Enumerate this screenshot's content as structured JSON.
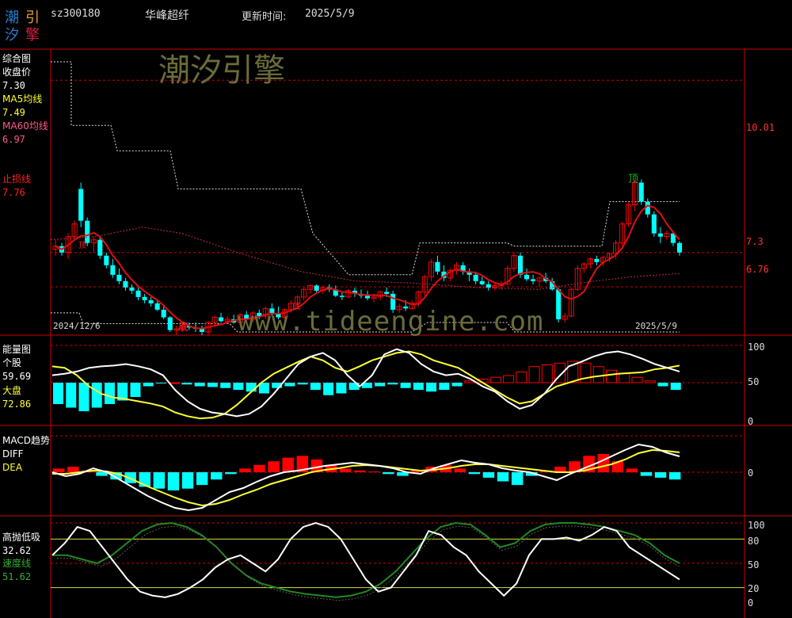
{
  "header": {
    "logo": "潮汐引擎",
    "code": "sz300180",
    "name": "华峰超纤",
    "update_label": "更新时间:",
    "update_date": "2025/5/9"
  },
  "watermark": {
    "brand": "潮汐引擎",
    "url": "www.tideengine.com"
  },
  "colors": {
    "up": "#ff0000",
    "down": "#00ffff",
    "white": "#ffffff",
    "yellow": "#ffff33",
    "red_line": "#e01010",
    "pink": "#ff5a8a",
    "green": "#208a20",
    "grid": "#cc0000",
    "watermark": "#6b6b3a"
  },
  "panels": {
    "main": {
      "title": "综合图",
      "close_label": "收盘价",
      "close_value": "7.30",
      "ma5_label": "MA5均线",
      "ma5_value": "7.49",
      "ma60_label": "MA60均线",
      "ma60_value": "6.97",
      "stop_label": "止损线",
      "stop_value": "7.76",
      "axis_labels": [
        "10.01",
        "7.3",
        "6.76"
      ],
      "date_start": "2024/12/6",
      "date_end": "2025/5/9",
      "marker_top": "顶",
      "marker_bottom": "底",
      "small_marks": [
        "顶",
        "底"
      ]
    },
    "energy": {
      "title": "能量图",
      "stock_label": "个股",
      "stock_value": "59.69",
      "market_label": "大盘",
      "market_value": "72.86",
      "axis_labels": [
        "100",
        "50",
        "0"
      ]
    },
    "macd": {
      "title": "MACD趋势",
      "diff_label": "DIFF",
      "dea_label": "DEA",
      "axis_labels": [
        "0"
      ]
    },
    "timing": {
      "title": "高抛低吸",
      "value": "32.62",
      "speed_label": "速度线",
      "speed_value": "51.62",
      "axis_labels": [
        "100",
        "80",
        "50",
        "20",
        "0"
      ]
    }
  },
  "chart_data": {
    "type": "candlestick",
    "x_range": [
      "2024/12/6",
      "2025/5/9"
    ],
    "price_axis": [
      6.76,
      7.3,
      10.01
    ],
    "candles_ohlc": [
      [
        7.35,
        7.5,
        7.25,
        7.4
      ],
      [
        7.4,
        7.45,
        7.25,
        7.3
      ],
      [
        7.3,
        7.6,
        7.2,
        7.55
      ],
      [
        7.55,
        7.8,
        7.5,
        7.75
      ],
      [
        8.3,
        8.4,
        7.7,
        7.8
      ],
      [
        7.8,
        7.85,
        7.4,
        7.45
      ],
      [
        7.45,
        7.55,
        7.3,
        7.5
      ],
      [
        7.5,
        7.55,
        7.2,
        7.25
      ],
      [
        7.25,
        7.3,
        7.05,
        7.1
      ],
      [
        7.1,
        7.2,
        6.9,
        6.95
      ],
      [
        6.95,
        7.05,
        6.8,
        6.85
      ],
      [
        6.85,
        6.9,
        6.7,
        6.75
      ],
      [
        6.75,
        6.8,
        6.65,
        6.7
      ],
      [
        6.7,
        6.75,
        6.55,
        6.6
      ],
      [
        6.6,
        6.65,
        6.5,
        6.55
      ],
      [
        6.55,
        6.6,
        6.45,
        6.5
      ],
      [
        6.5,
        6.55,
        6.38,
        6.4
      ],
      [
        6.4,
        6.45,
        6.25,
        6.28
      ],
      [
        6.28,
        6.3,
        6.05,
        6.08
      ],
      [
        6.08,
        6.15,
        6.0,
        6.1
      ],
      [
        6.1,
        6.18,
        6.05,
        6.15
      ],
      [
        6.15,
        6.2,
        6.08,
        6.12
      ],
      [
        6.12,
        6.2,
        6.05,
        6.1
      ],
      [
        6.1,
        6.15,
        6.0,
        6.05
      ],
      [
        6.05,
        6.22,
        6.0,
        6.2
      ],
      [
        6.2,
        6.3,
        6.12,
        6.28
      ],
      [
        6.28,
        6.35,
        6.2,
        6.22
      ],
      [
        6.22,
        6.3,
        6.18,
        6.25
      ],
      [
        6.25,
        6.32,
        6.18,
        6.2
      ],
      [
        6.2,
        6.35,
        6.15,
        6.32
      ],
      [
        6.32,
        6.38,
        6.22,
        6.25
      ],
      [
        6.25,
        6.38,
        6.2,
        6.35
      ],
      [
        6.35,
        6.4,
        6.25,
        6.3
      ],
      [
        6.3,
        6.45,
        6.25,
        6.42
      ],
      [
        6.42,
        6.5,
        6.3,
        6.35
      ],
      [
        6.35,
        6.45,
        6.25,
        6.28
      ],
      [
        6.28,
        6.42,
        6.25,
        6.4
      ],
      [
        6.4,
        6.55,
        6.35,
        6.5
      ],
      [
        6.5,
        6.62,
        6.45,
        6.6
      ],
      [
        6.6,
        6.75,
        6.55,
        6.72
      ],
      [
        6.72,
        6.8,
        6.65,
        6.78
      ],
      [
        6.78,
        6.8,
        6.65,
        6.7
      ],
      [
        6.7,
        6.78,
        6.65,
        6.75
      ],
      [
        6.75,
        6.8,
        6.68,
        6.72
      ],
      [
        6.72,
        6.78,
        6.6,
        6.62
      ],
      [
        6.62,
        6.68,
        6.55,
        6.6
      ],
      [
        6.6,
        6.72,
        6.58,
        6.7
      ],
      [
        6.7,
        6.75,
        6.6,
        6.65
      ],
      [
        6.65,
        6.72,
        6.58,
        6.62
      ],
      [
        6.62,
        6.7,
        6.55,
        6.58
      ],
      [
        6.58,
        6.65,
        6.52,
        6.6
      ],
      [
        6.6,
        6.7,
        6.55,
        6.68
      ],
      [
        6.68,
        6.75,
        6.6,
        6.65
      ],
      [
        6.65,
        6.7,
        6.35,
        6.4
      ],
      [
        6.4,
        6.5,
        6.35,
        6.45
      ],
      [
        6.45,
        6.55,
        6.38,
        6.42
      ],
      [
        6.42,
        6.55,
        6.4,
        6.5
      ],
      [
        6.5,
        6.7,
        6.45,
        6.68
      ],
      [
        6.68,
        6.95,
        6.6,
        6.92
      ],
      [
        6.92,
        7.2,
        6.85,
        7.15
      ],
      [
        7.15,
        7.25,
        6.95,
        7.0
      ],
      [
        7.0,
        7.1,
        6.85,
        6.9
      ],
      [
        6.9,
        7.05,
        6.85,
        7.02
      ],
      [
        7.02,
        7.15,
        6.95,
        7.1
      ],
      [
        7.1,
        7.15,
        6.95,
        7.0
      ],
      [
        7.0,
        7.05,
        6.85,
        6.95
      ],
      [
        6.95,
        7.0,
        6.8,
        6.85
      ],
      [
        6.85,
        6.92,
        6.78,
        6.8
      ],
      [
        6.8,
        6.85,
        6.7,
        6.75
      ],
      [
        6.75,
        6.82,
        6.7,
        6.78
      ],
      [
        6.78,
        6.85,
        6.72,
        6.8
      ],
      [
        6.8,
        7.1,
        6.8,
        7.05
      ],
      [
        7.05,
        7.3,
        7.0,
        7.25
      ],
      [
        7.25,
        7.3,
        6.9,
        6.95
      ],
      [
        6.95,
        7.05,
        6.85,
        6.88
      ],
      [
        6.88,
        6.95,
        6.8,
        6.85
      ],
      [
        6.85,
        6.92,
        6.75,
        6.9
      ],
      [
        6.9,
        6.98,
        6.82,
        6.85
      ],
      [
        6.85,
        6.9,
        6.7,
        6.72
      ],
      [
        6.72,
        6.75,
        6.2,
        6.25
      ],
      [
        6.25,
        6.35,
        6.2,
        6.3
      ],
      [
        6.3,
        6.75,
        6.28,
        6.72
      ],
      [
        6.72,
        7.1,
        6.7,
        7.05
      ],
      [
        7.05,
        7.15,
        6.98,
        7.12
      ],
      [
        7.12,
        7.22,
        7.05,
        7.2
      ],
      [
        7.2,
        7.25,
        7.1,
        7.15
      ],
      [
        7.15,
        7.25,
        7.08,
        7.22
      ],
      [
        7.22,
        7.3,
        7.15,
        7.28
      ],
      [
        7.28,
        7.5,
        7.2,
        7.45
      ],
      [
        7.45,
        7.78,
        7.4,
        7.75
      ],
      [
        7.75,
        8.1,
        7.7,
        8.05
      ],
      [
        8.05,
        8.45,
        7.95,
        8.4
      ],
      [
        8.4,
        8.45,
        8.05,
        8.1
      ],
      [
        8.1,
        8.15,
        7.85,
        7.9
      ],
      [
        7.9,
        7.95,
        7.55,
        7.6
      ],
      [
        7.6,
        7.7,
        7.45,
        7.55
      ],
      [
        7.55,
        7.65,
        7.5,
        7.6
      ],
      [
        7.6,
        7.62,
        7.4,
        7.45
      ],
      [
        7.45,
        7.48,
        7.25,
        7.3
      ]
    ],
    "energy_stock_values": [
      60,
      62,
      65,
      70,
      72,
      73,
      75,
      72,
      68,
      60,
      40,
      25,
      15,
      10,
      8,
      5,
      8,
      18,
      35,
      55,
      75,
      85,
      90,
      80,
      60,
      45,
      60,
      88,
      95,
      90,
      75,
      65,
      60,
      62,
      55,
      45,
      38,
      25,
      15,
      20,
      35,
      55,
      72,
      78,
      85,
      90,
      92,
      88,
      82,
      75,
      70,
      65
    ],
    "energy_market_values": [
      72,
      70,
      60,
      45,
      35,
      30,
      28,
      25,
      22,
      18,
      10,
      5,
      2,
      3,
      8,
      20,
      35,
      50,
      62,
      70,
      78,
      85,
      80,
      70,
      65,
      72,
      80,
      85,
      90,
      92,
      88,
      80,
      75,
      70,
      60,
      50,
      40,
      30,
      22,
      25,
      35,
      45,
      50,
      55,
      58,
      60,
      62,
      63,
      64,
      68,
      70,
      73
    ],
    "energy_stock_bars": [
      -0.6,
      -0.7,
      -0.8,
      -0.7,
      -0.6,
      -0.5,
      -0.4,
      -0.1,
      -0.02,
      0,
      -0.05,
      -0.1,
      -0.12,
      -0.15,
      -0.2,
      -0.25,
      -0.3,
      -0.15,
      -0.1,
      -0.05,
      -0.2,
      -0.35,
      -0.3,
      -0.2,
      -0.15,
      -0.1,
      -0.05,
      -0.15,
      -0.2,
      -0.25,
      -0.2,
      -0.1,
      0.05,
      0.1,
      0.15,
      0.2,
      0.3,
      0.45,
      0.5,
      0.55,
      0.6,
      0.55,
      0.45,
      0.35,
      0.25,
      0.15,
      0.05,
      -0.1,
      -0.2
    ],
    "macd_diff": [
      0,
      -0.05,
      -0.02,
      0.05,
      0.0,
      -0.1,
      -0.2,
      -0.3,
      -0.38,
      -0.45,
      -0.48,
      -0.45,
      -0.35,
      -0.25,
      -0.2,
      -0.12,
      -0.05,
      0.0,
      0.02,
      0.05,
      0.08,
      0.1,
      0.12,
      0.1,
      0.08,
      0.05,
      0.0,
      -0.02,
      0.05,
      0.1,
      0.15,
      0.12,
      0.1,
      0.05,
      0.02,
      0.0,
      -0.05,
      -0.1,
      -0.02,
      0.05,
      0.12,
      0.2,
      0.28,
      0.35,
      0.32,
      0.25,
      0.2
    ],
    "macd_dea": [
      -0.02,
      -0.02,
      0.0,
      0.02,
      0.01,
      -0.03,
      -0.1,
      -0.18,
      -0.25,
      -0.32,
      -0.38,
      -0.42,
      -0.4,
      -0.35,
      -0.28,
      -0.22,
      -0.15,
      -0.1,
      -0.05,
      0.0,
      0.03,
      0.05,
      0.08,
      0.09,
      0.08,
      0.06,
      0.04,
      0.02,
      0.03,
      0.05,
      0.08,
      0.1,
      0.1,
      0.08,
      0.06,
      0.04,
      0.02,
      0.0,
      0.0,
      0.02,
      0.06,
      0.1,
      0.16,
      0.24,
      0.28,
      0.27,
      0.25
    ],
    "macd_hist": [
      0.1,
      0.15,
      0.05,
      -0.1,
      -0.2,
      -0.3,
      -0.4,
      -0.45,
      -0.5,
      -0.45,
      -0.35,
      -0.2,
      -0.05,
      0.1,
      0.2,
      0.3,
      0.4,
      0.45,
      0.35,
      0.2,
      0.1,
      0.05,
      0.02,
      -0.05,
      -0.1,
      0.05,
      0.15,
      0.2,
      0.1,
      -0.05,
      -0.15,
      -0.25,
      -0.35,
      -0.1,
      0.05,
      0.15,
      0.3,
      0.45,
      0.5,
      0.3,
      0.1,
      -0.1,
      -0.15,
      -0.2
    ],
    "timing_value": [
      60,
      75,
      95,
      90,
      70,
      50,
      30,
      15,
      10,
      8,
      12,
      20,
      30,
      45,
      55,
      60,
      50,
      40,
      55,
      80,
      95,
      100,
      95,
      80,
      55,
      30,
      15,
      20,
      40,
      60,
      90,
      85,
      70,
      60,
      40,
      25,
      10,
      25,
      60,
      80,
      80,
      82,
      78,
      85,
      95,
      90,
      70,
      60,
      50,
      40,
      30
    ],
    "timing_speed": [
      60,
      60,
      55,
      50,
      60,
      75,
      90,
      98,
      100,
      95,
      85,
      70,
      50,
      35,
      25,
      20,
      15,
      12,
      10,
      8,
      10,
      15,
      25,
      40,
      60,
      80,
      95,
      100,
      98,
      85,
      70,
      75,
      90,
      98,
      100,
      100,
      98,
      95,
      90,
      85,
      75,
      60,
      50
    ]
  }
}
